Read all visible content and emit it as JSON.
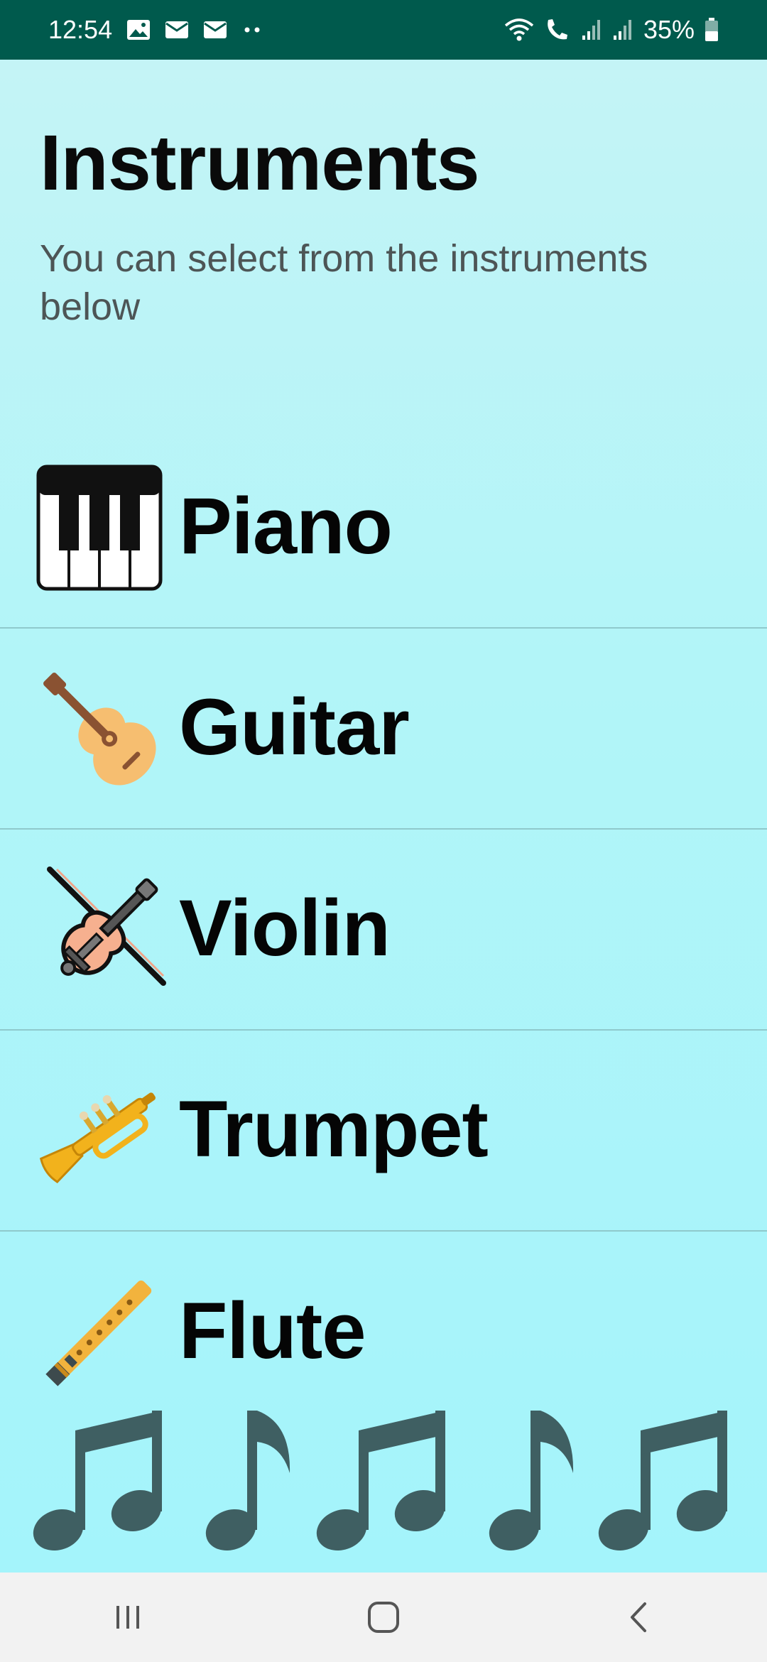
{
  "status_bar": {
    "time": "12:54",
    "battery": "35%",
    "left_icons": [
      "image-icon",
      "mail-icon",
      "mail-icon",
      "more-dots-icon"
    ],
    "right_icons": [
      "wifi-icon",
      "call-icon",
      "signal-icon",
      "signal-icon",
      "battery-icon"
    ]
  },
  "header": {
    "title": "Instruments",
    "subtitle": "You can select from the instruments below"
  },
  "instruments": [
    {
      "label": "Piano",
      "icon": "piano-icon"
    },
    {
      "label": "Guitar",
      "icon": "guitar-icon"
    },
    {
      "label": "Violin",
      "icon": "violin-icon"
    },
    {
      "label": "Trumpet",
      "icon": "trumpet-icon"
    },
    {
      "label": "Flute",
      "icon": "flute-icon"
    }
  ],
  "decoration": {
    "notes": [
      "beamed-notes-icon",
      "eighth-note-icon",
      "beamed-notes-icon",
      "eighth-note-icon",
      "beamed-notes-icon"
    ]
  },
  "nav": {
    "buttons": [
      "recent-apps-icon",
      "home-icon",
      "back-icon"
    ]
  },
  "colors": {
    "status_bar": "#005a4d",
    "background_top": "#c4f4f6",
    "background_bottom": "#a4f4fb",
    "divider": "#8fc9cc",
    "note": "#3f5f62",
    "nav_bar": "#f2f2f2"
  }
}
